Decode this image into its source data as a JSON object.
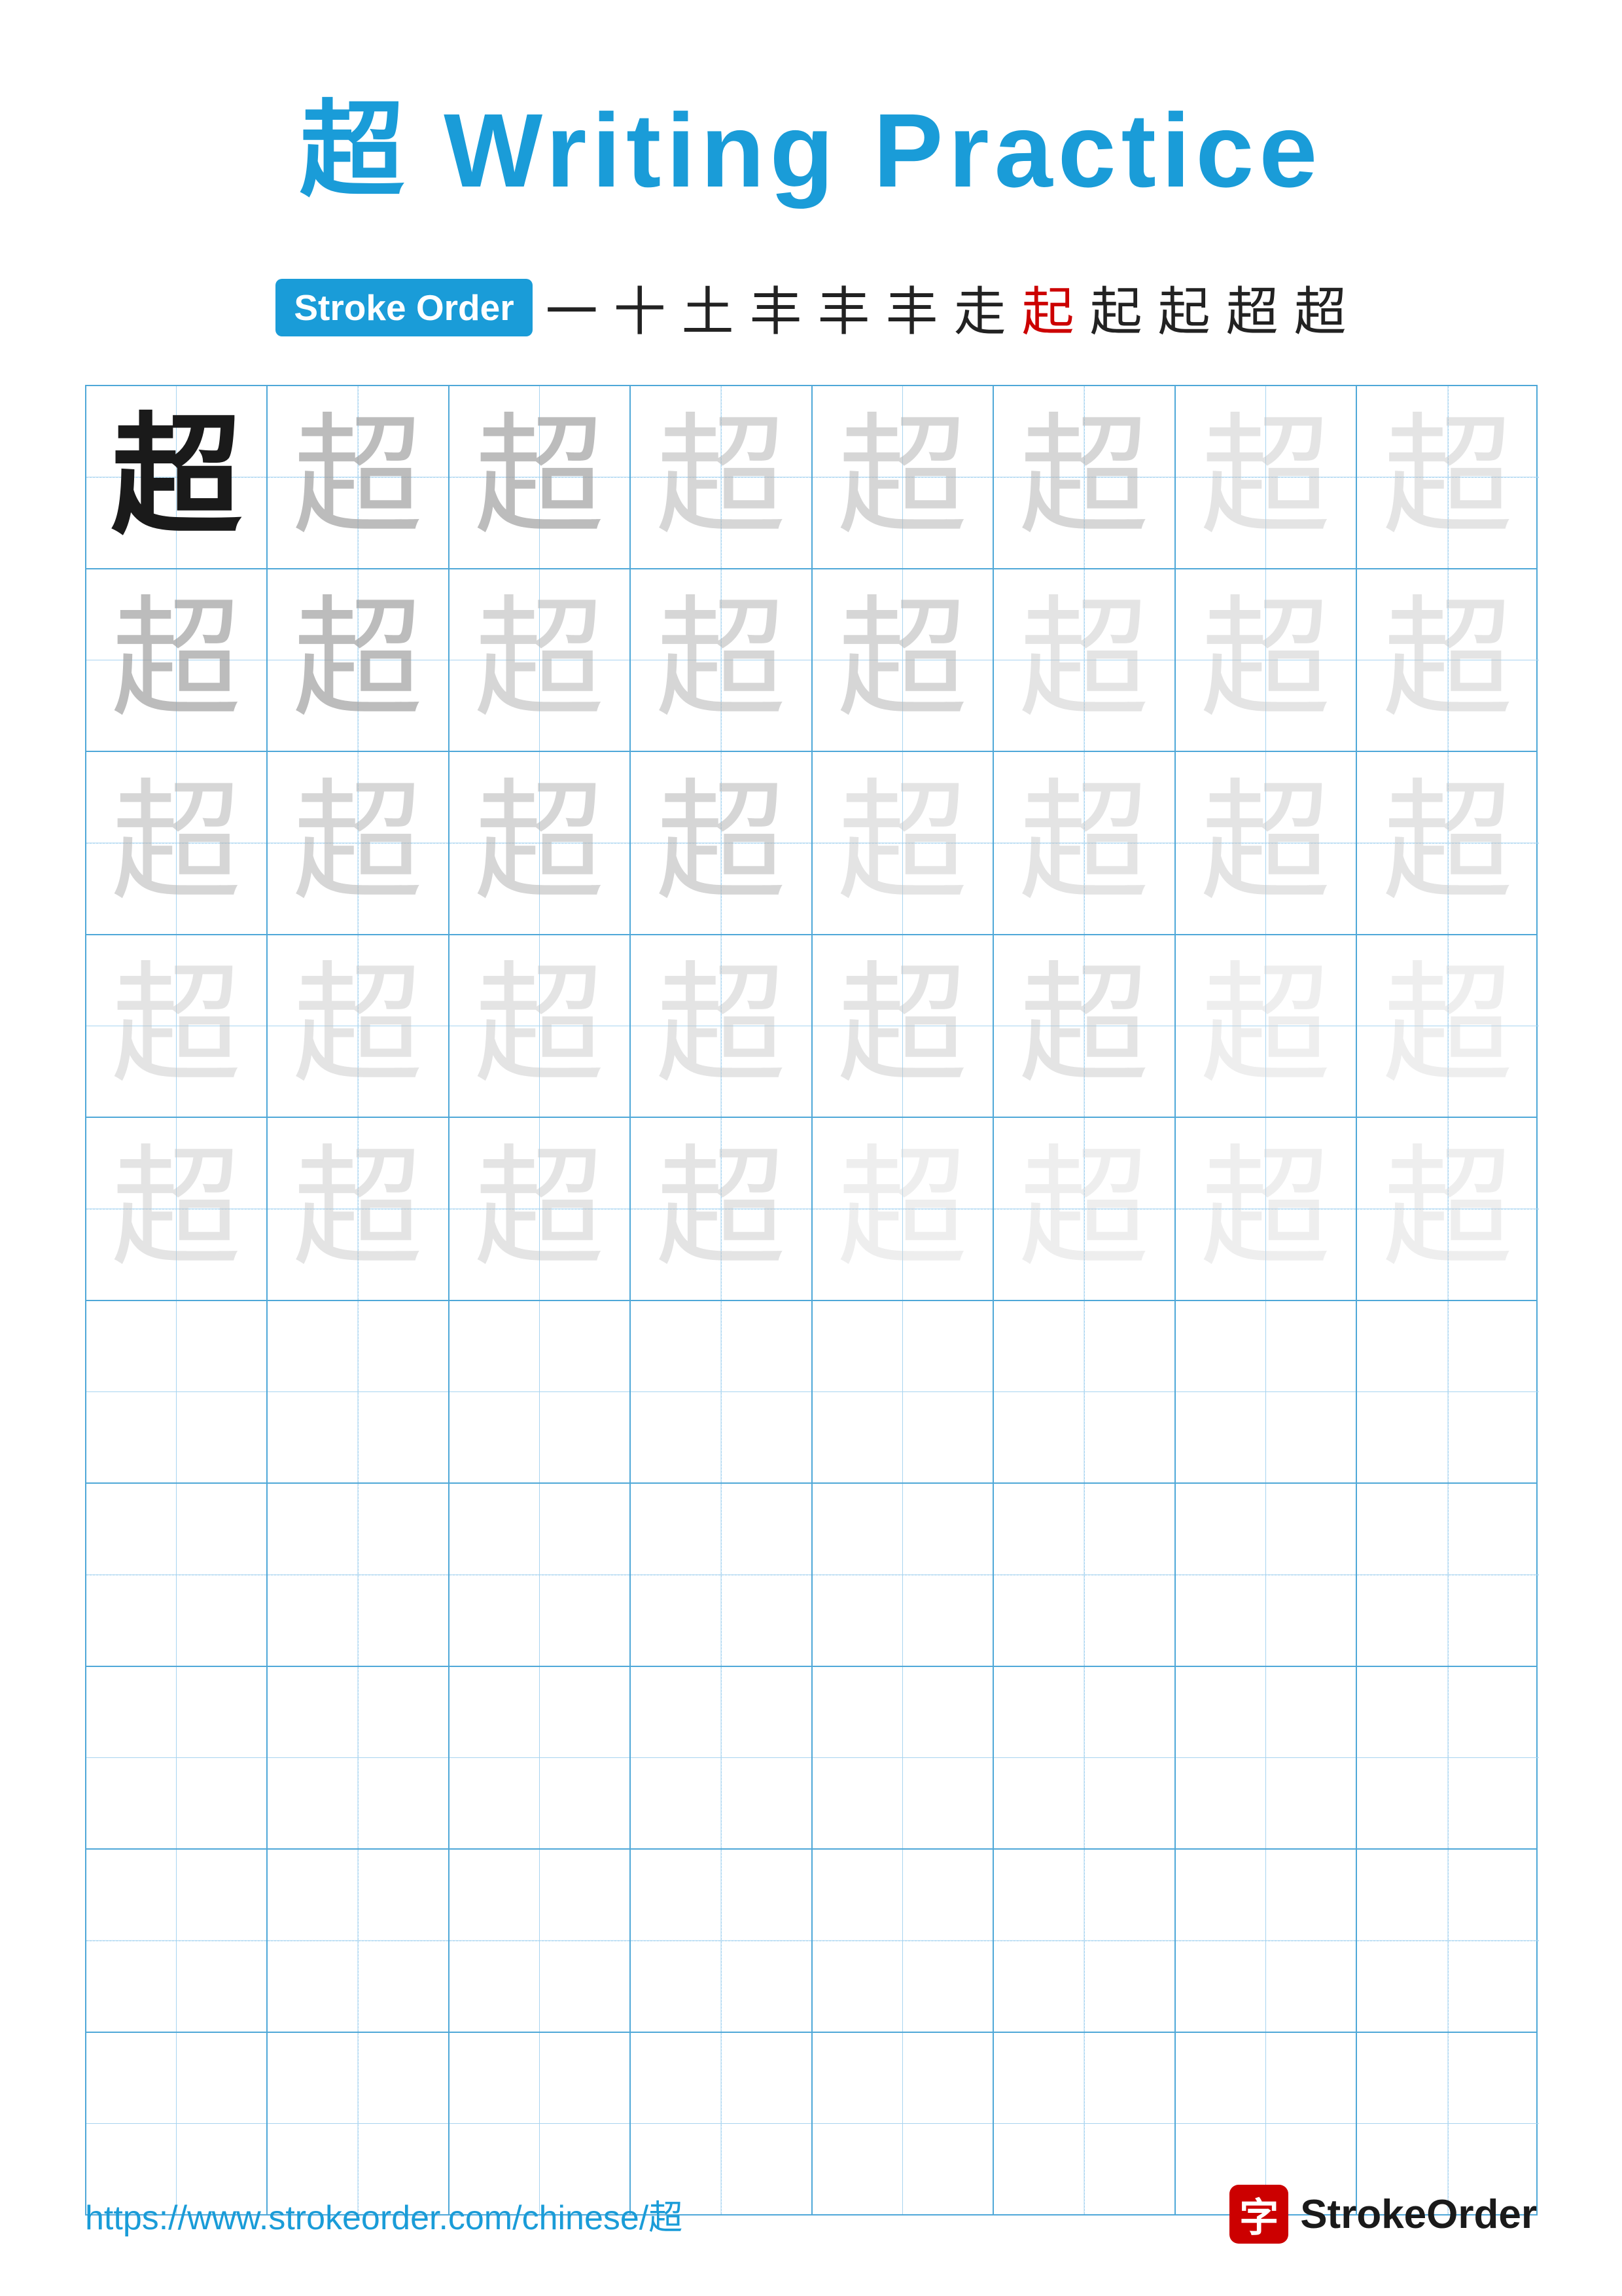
{
  "title": {
    "char": "超",
    "text": " Writing Practice"
  },
  "stroke_order": {
    "badge": "Stroke Order",
    "strokes": [
      "一",
      "十",
      "土",
      "丰",
      "丰",
      "丰",
      "走",
      "起",
      "起",
      "起",
      "超",
      "超"
    ],
    "red_index": 7
  },
  "grid": {
    "rows": 10,
    "cols": 8,
    "char": "超",
    "practice_rows": 5,
    "empty_rows": 5
  },
  "footer": {
    "url": "https://www.strokeorder.com/chinese/超",
    "logo_char": "字",
    "logo_text": "StrokeOrder"
  }
}
